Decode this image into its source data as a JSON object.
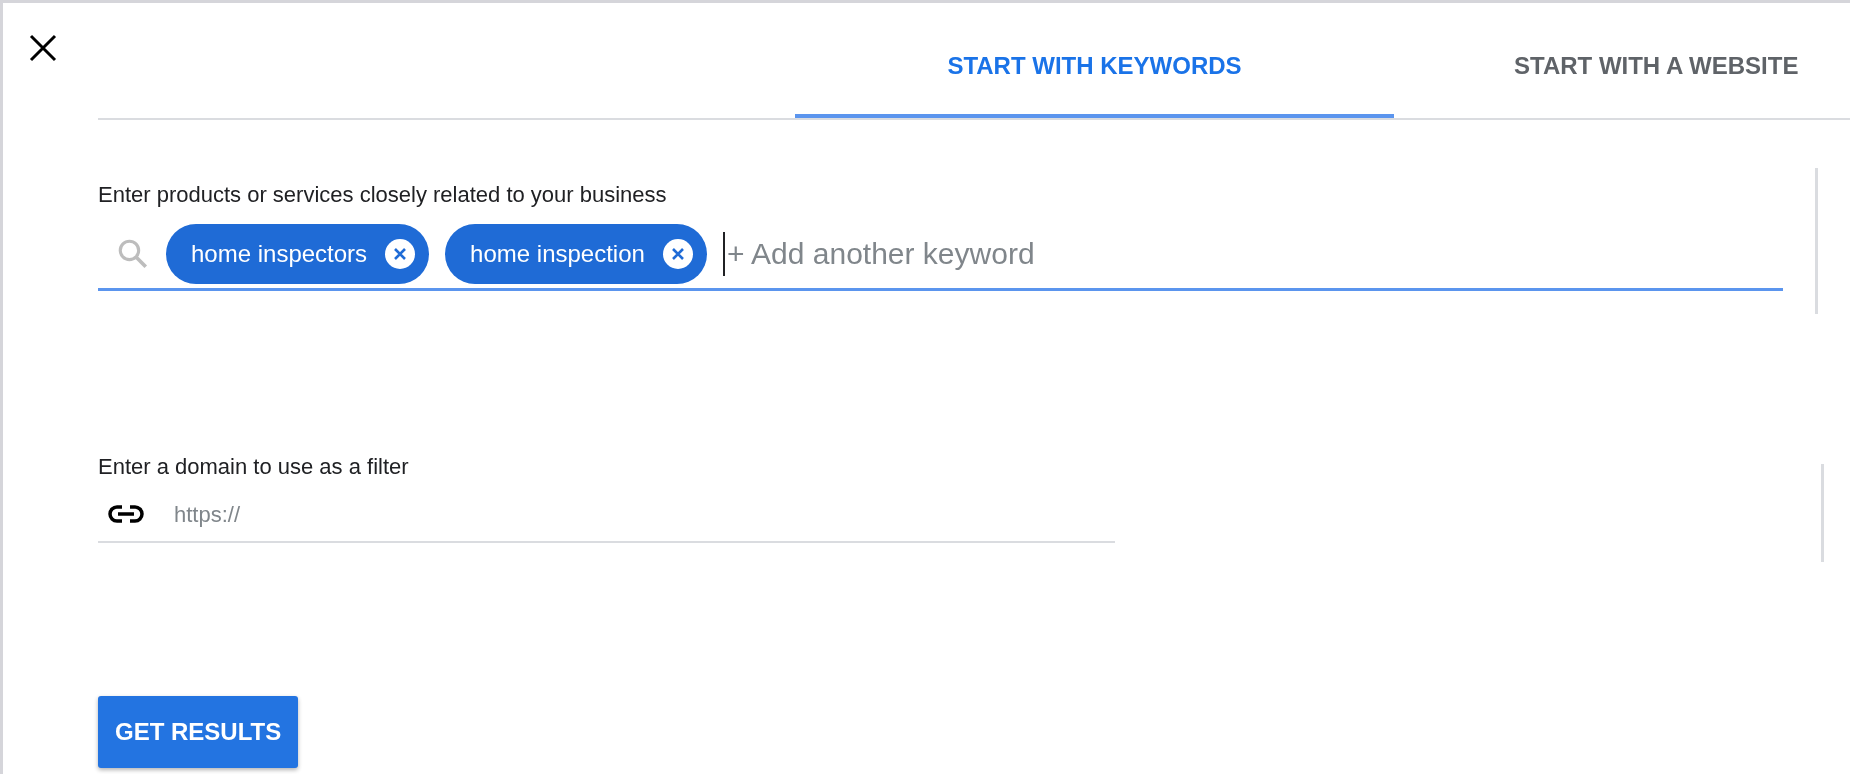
{
  "tabs": [
    {
      "label": "START WITH KEYWORDS",
      "selected": true
    },
    {
      "label": "START WITH A WEBSITE",
      "selected": false
    }
  ],
  "keywords": {
    "label": "Enter products or services closely related to your business",
    "chips": [
      "home inspectors",
      "home inspection"
    ],
    "placeholder": "+ Add another keyword",
    "focused": true
  },
  "domain": {
    "label": "Enter a domain to use as a filter",
    "placeholder": "https://"
  },
  "buttons": [
    "GET RESULTS"
  ]
}
